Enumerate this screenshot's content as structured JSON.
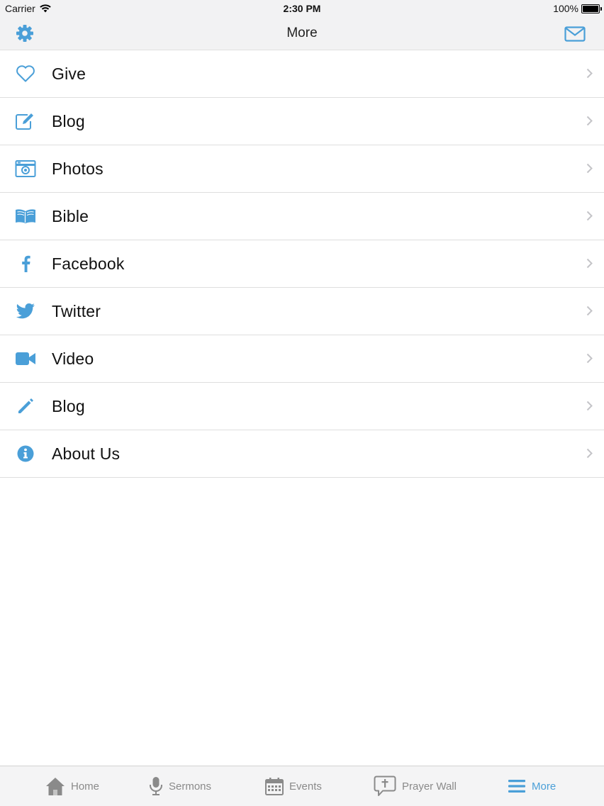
{
  "status": {
    "carrier": "Carrier",
    "time": "2:30 PM",
    "battery": "100%"
  },
  "nav": {
    "title": "More",
    "left_icon": "gear-icon",
    "right_icon": "mail-icon"
  },
  "accent_color": "#4a9fd8",
  "menu": [
    {
      "label": "Give",
      "icon": "heart-icon"
    },
    {
      "label": "Blog",
      "icon": "edit-icon"
    },
    {
      "label": "Photos",
      "icon": "camera-icon"
    },
    {
      "label": "Bible",
      "icon": "book-icon"
    },
    {
      "label": "Facebook",
      "icon": "facebook-icon"
    },
    {
      "label": "Twitter",
      "icon": "twitter-icon"
    },
    {
      "label": "Video",
      "icon": "video-icon"
    },
    {
      "label": "Blog",
      "icon": "pencil-icon"
    },
    {
      "label": "About Us",
      "icon": "info-icon"
    }
  ],
  "tabs": [
    {
      "label": "Home",
      "icon": "home-icon",
      "active": false
    },
    {
      "label": "Sermons",
      "icon": "microphone-icon",
      "active": false
    },
    {
      "label": "Events",
      "icon": "calendar-icon",
      "active": false
    },
    {
      "label": "Prayer Wall",
      "icon": "prayer-bubble-icon",
      "active": false
    },
    {
      "label": "More",
      "icon": "menu-icon",
      "active": true
    }
  ]
}
